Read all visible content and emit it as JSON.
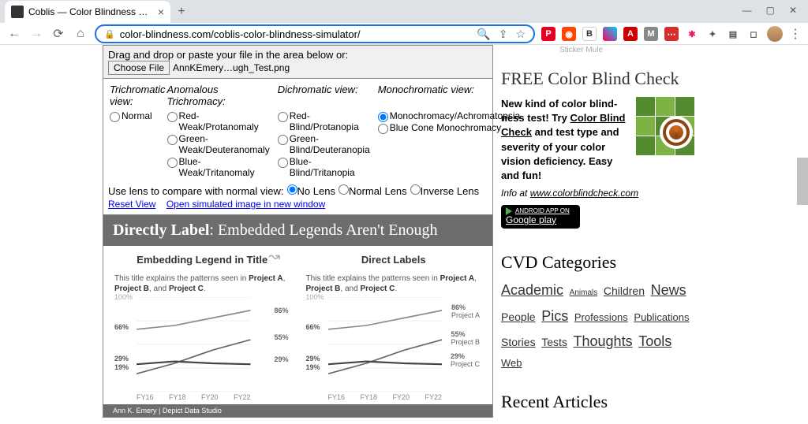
{
  "browser": {
    "tab_title": "Coblis — Color Blindness Simul",
    "url": "color-blindness.com/coblis-color-blindness-simulator/",
    "window": {
      "min": "—",
      "max": "▢",
      "close": "✕"
    }
  },
  "upload": {
    "instruction": "Drag and drop or paste your file in the area below or:",
    "button": "Choose File",
    "filename": "AnnKEmery…ugh_Test.png"
  },
  "views": {
    "trichromatic": {
      "header": "Trichromatic view:",
      "normal": "Normal"
    },
    "anomalous": {
      "header": "Anomalous Trichromacy:",
      "red": "Red-Weak/Protanomaly",
      "green": "Green-Weak/Deuteranomaly",
      "blue": "Blue-Weak/Tritanomaly"
    },
    "dichromatic": {
      "header": "Dichromatic view:",
      "red": "Red-Blind/Protanopia",
      "green": "Green-Blind/Deuteranopia",
      "blue": "Blue-Blind/Tritanopia"
    },
    "mono": {
      "header": "Monochromatic view:",
      "achroma": "Monochromacy/Achromatopsia",
      "bluecone": "Blue Cone Monochromacy"
    }
  },
  "lens": {
    "label": "Use lens to compare with normal view:",
    "none": "No Lens",
    "normal": "Normal Lens",
    "inverse": "Inverse Lens"
  },
  "links": {
    "reset": "Reset View",
    "open": "Open simulated image in new window"
  },
  "sim": {
    "header_bold": "Directly Label",
    "header_rest": ": Embedded Legends Aren't Enough",
    "left_title": "Embedding Legend in Title",
    "right_title": "Direct Labels",
    "subtitle_pre": "This title explains the patterns seen in ",
    "pa": "Project A",
    "pb": "Project B",
    "pc": "Project C",
    "footer": "Ann K. Emery | Depict Data Studio"
  },
  "chart_data": {
    "type": "line",
    "x": [
      "FY16",
      "FY18",
      "FY20",
      "FY22"
    ],
    "ylim": [
      0,
      100
    ],
    "y_ticks_left": [
      "100%",
      "66%",
      "29%",
      "19%"
    ],
    "series": [
      {
        "name": "Project A",
        "values": [
          66,
          70,
          78,
          86
        ],
        "end_label": "86%"
      },
      {
        "name": "Project B",
        "values": [
          19,
          30,
          44,
          55
        ],
        "end_label": "55%"
      },
      {
        "name": "Project C",
        "values": [
          29,
          32,
          30,
          29
        ],
        "end_label": "29%"
      }
    ]
  },
  "sidebar": {
    "cb_title": "FREE Color Blind Check",
    "cb_text_1": "New kind of color blind-ness test! Try ",
    "cb_link": "Color Blind Check",
    "cb_text_2": " and test type and severity of your color vision deficiency. Easy and fun!",
    "cb_info_pre": "Info at ",
    "cb_info_link": "www.colorblindcheck.com",
    "gplay_small": "ANDROID APP ON",
    "gplay_big": "Google play",
    "cat_title": "CVD Categories",
    "cats": {
      "academic": "Academic",
      "animals": "Animals",
      "children": "Children",
      "news": "News",
      "people": "People",
      "pics": "Pics",
      "professions": "Professions",
      "publications": "Publications",
      "stories": "Stories",
      "tests": "Tests",
      "thoughts": "Thoughts",
      "tools": "Tools",
      "web": "Web"
    },
    "ra_title": "Recent Articles",
    "sticker": "Sticker Mule"
  }
}
